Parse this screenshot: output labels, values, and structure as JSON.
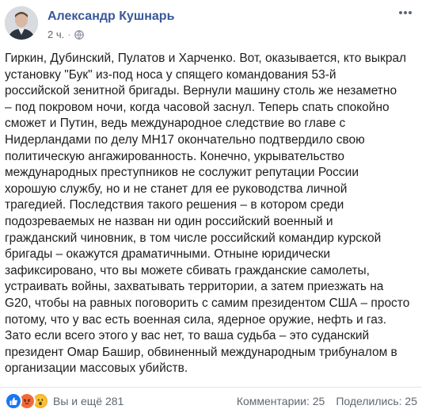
{
  "post": {
    "author": "Александр Кушнарь",
    "time": "2 ч.",
    "separator": "·",
    "body": "Гиркин, Дубинский, Пулатов и Харченко. Вот, оказывается, кто выкрал\nустановку \"Бук\" из-под носа у спящего командования 53-й\nроссийской зенитной бригады. Вернули машину столь же незаметно\n– под покровом ночи, когда часовой заснул. Теперь спать спокойно\nсможет и Путин, ведь международное следствие во главе с\nНидерландами по делу МН17 окончательно подтвердило свою\nполитическую ангажированность. Конечно, укрывательство\nмеждународных преступников не сослужит репутации России\nхорошую службу, но и не станет для ее руководства личной\nтрагедией. Последствия такого решения – в котором среди\nподозреваемых не назван ни один российский военный и\nгражданский чиновник, в том числе российский командир курской\nбригады – окажутся драматичными. Отныне юридически\nзафиксировано, что вы можете сбивать гражданские самолеты,\nустраивать войны, захватывать территории, а затем приезжать на\nG20, чтобы на равных поговорить с самим президентом США – просто\nпотому, что у вас есть военная сила, ядерное оружие, нефть и газ.\nЗато если всего этого у вас нет, то ваша судьба – это суданский\nпрезидент Омар Башир, обвиненный международным трибуналом в\nорганизации массовых убийств."
  },
  "footer": {
    "reactions_text": "Вы и ещё 281",
    "comments": "Комментарии: 25",
    "shares": "Поделились: 25"
  },
  "icons": {
    "reactions": [
      "like-icon",
      "angry-icon",
      "wow-icon"
    ],
    "privacy": "globe-icon",
    "menu": "more-options-icon"
  },
  "colors": {
    "author": "#385898",
    "meta": "#616770",
    "like": "#1877f2",
    "angry": "#f26f38",
    "wow": "#f7b125"
  }
}
